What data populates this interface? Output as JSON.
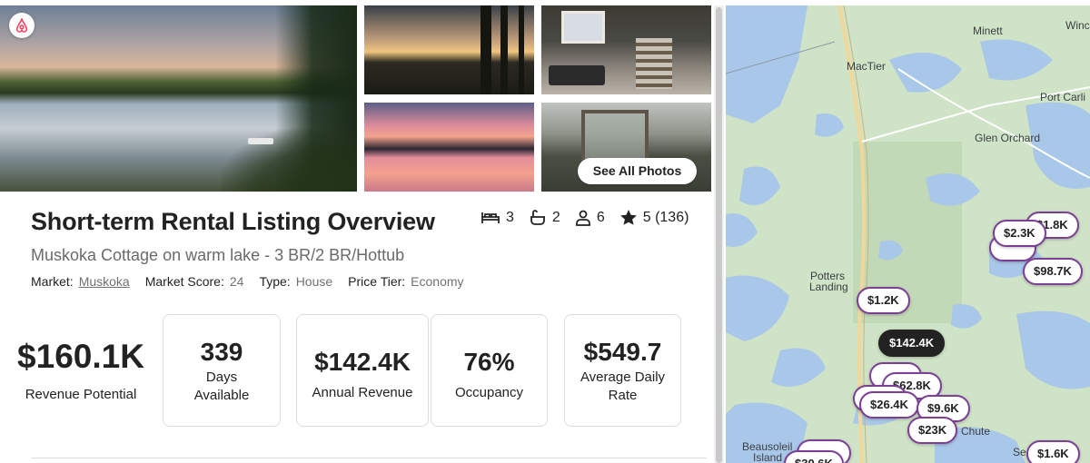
{
  "colors": {
    "accent": "#7b3f95",
    "active_pin": "#222222",
    "text_primary": "#222222",
    "text_secondary": "#717171",
    "brand": "#ff385c"
  },
  "photos": {
    "logo_icon": "airbnb-logo-icon",
    "see_all_label": "See All Photos"
  },
  "listing": {
    "title": "Short-term Rental Listing Overview",
    "subtitle": "Muskoka Cottage on warm lake - 3 BR/2 BR/Hottub",
    "stats": {
      "bedrooms": "3",
      "bathrooms": "2",
      "guests": "6",
      "rating": "5 (136)"
    },
    "meta": [
      {
        "key": "Market:",
        "value": "Muskoka",
        "link": true
      },
      {
        "key": "Market Score:",
        "value": "24"
      },
      {
        "key": "Type:",
        "value": "House"
      },
      {
        "key": "Price Tier:",
        "value": "Economy"
      }
    ]
  },
  "metrics": {
    "revenue_potential": {
      "value": "$160.1K",
      "label": "Revenue Potential"
    },
    "days_available": {
      "value": "339",
      "label_1": "Days",
      "label_2": "Available"
    },
    "annual_revenue": {
      "value": "$142.4K",
      "label": "Annual Revenue"
    },
    "occupancy": {
      "value": "76%",
      "label": "Occupancy"
    },
    "adr": {
      "value": "$549.7",
      "label_1": "Average Daily",
      "label_2": "Rate"
    }
  },
  "map": {
    "towns": [
      "Minett",
      "Winc",
      "MacTier",
      "Port Carli",
      "Glen Orchard",
      "Potters",
      "Landing",
      "Beausoleil",
      "Island",
      "Chute",
      "Se"
    ],
    "pins": [
      "$1.8K",
      "$2.3K",
      "$98.7K",
      "$1.2K",
      "$142.4K",
      "$62.8K",
      "$26.4K",
      "$9.6K",
      "$23K",
      "$1.6K",
      "$30.6K"
    ]
  }
}
